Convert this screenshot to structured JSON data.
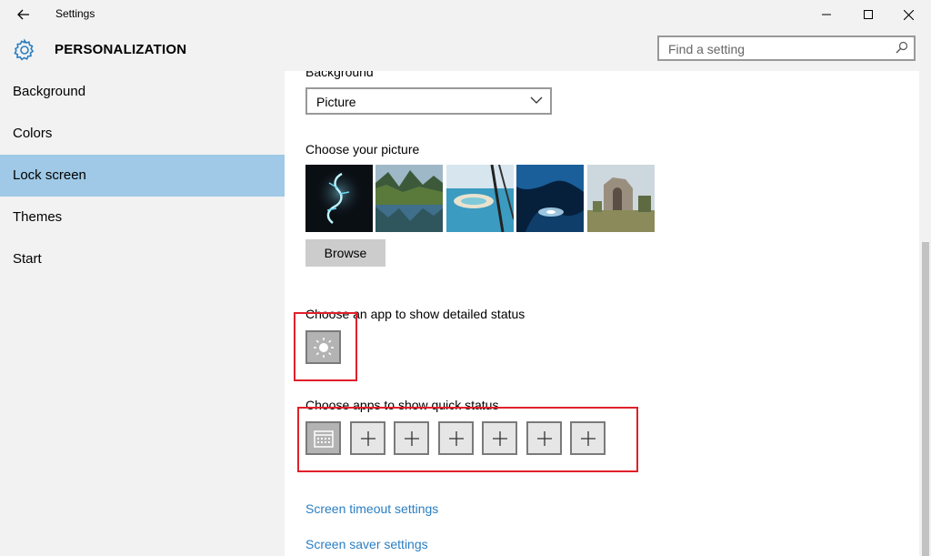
{
  "window": {
    "title": "Settings"
  },
  "header": {
    "title": "PERSONALIZATION",
    "search_placeholder": "Find a setting"
  },
  "sidebar": {
    "items": [
      {
        "label": "Background",
        "selected": false
      },
      {
        "label": "Colors",
        "selected": false
      },
      {
        "label": "Lock screen",
        "selected": true
      },
      {
        "label": "Themes",
        "selected": false
      },
      {
        "label": "Start",
        "selected": false
      }
    ]
  },
  "content": {
    "background_label": "Background",
    "background_value": "Picture",
    "choose_picture_label": "Choose your picture",
    "pictures": [
      "dragon-wallpaper",
      "mountain-lake",
      "coastal-aerial",
      "ice-cave",
      "stone-ruins"
    ],
    "browse_label": "Browse",
    "detailed_status_label": "Choose an app to show detailed status",
    "detailed_status_app_icon": "weather-sun-icon",
    "quick_status_label": "Choose apps to show quick status",
    "quick_status_tiles": [
      "calendar-icon",
      "plus-icon",
      "plus-icon",
      "plus-icon",
      "plus-icon",
      "plus-icon",
      "plus-icon"
    ],
    "screen_timeout_link": "Screen timeout settings",
    "screen_saver_link": "Screen saver settings"
  },
  "colors": {
    "accent_selected": "#9fc9e6",
    "link": "#2a7ec2",
    "highlight_box": "#e0202b"
  }
}
